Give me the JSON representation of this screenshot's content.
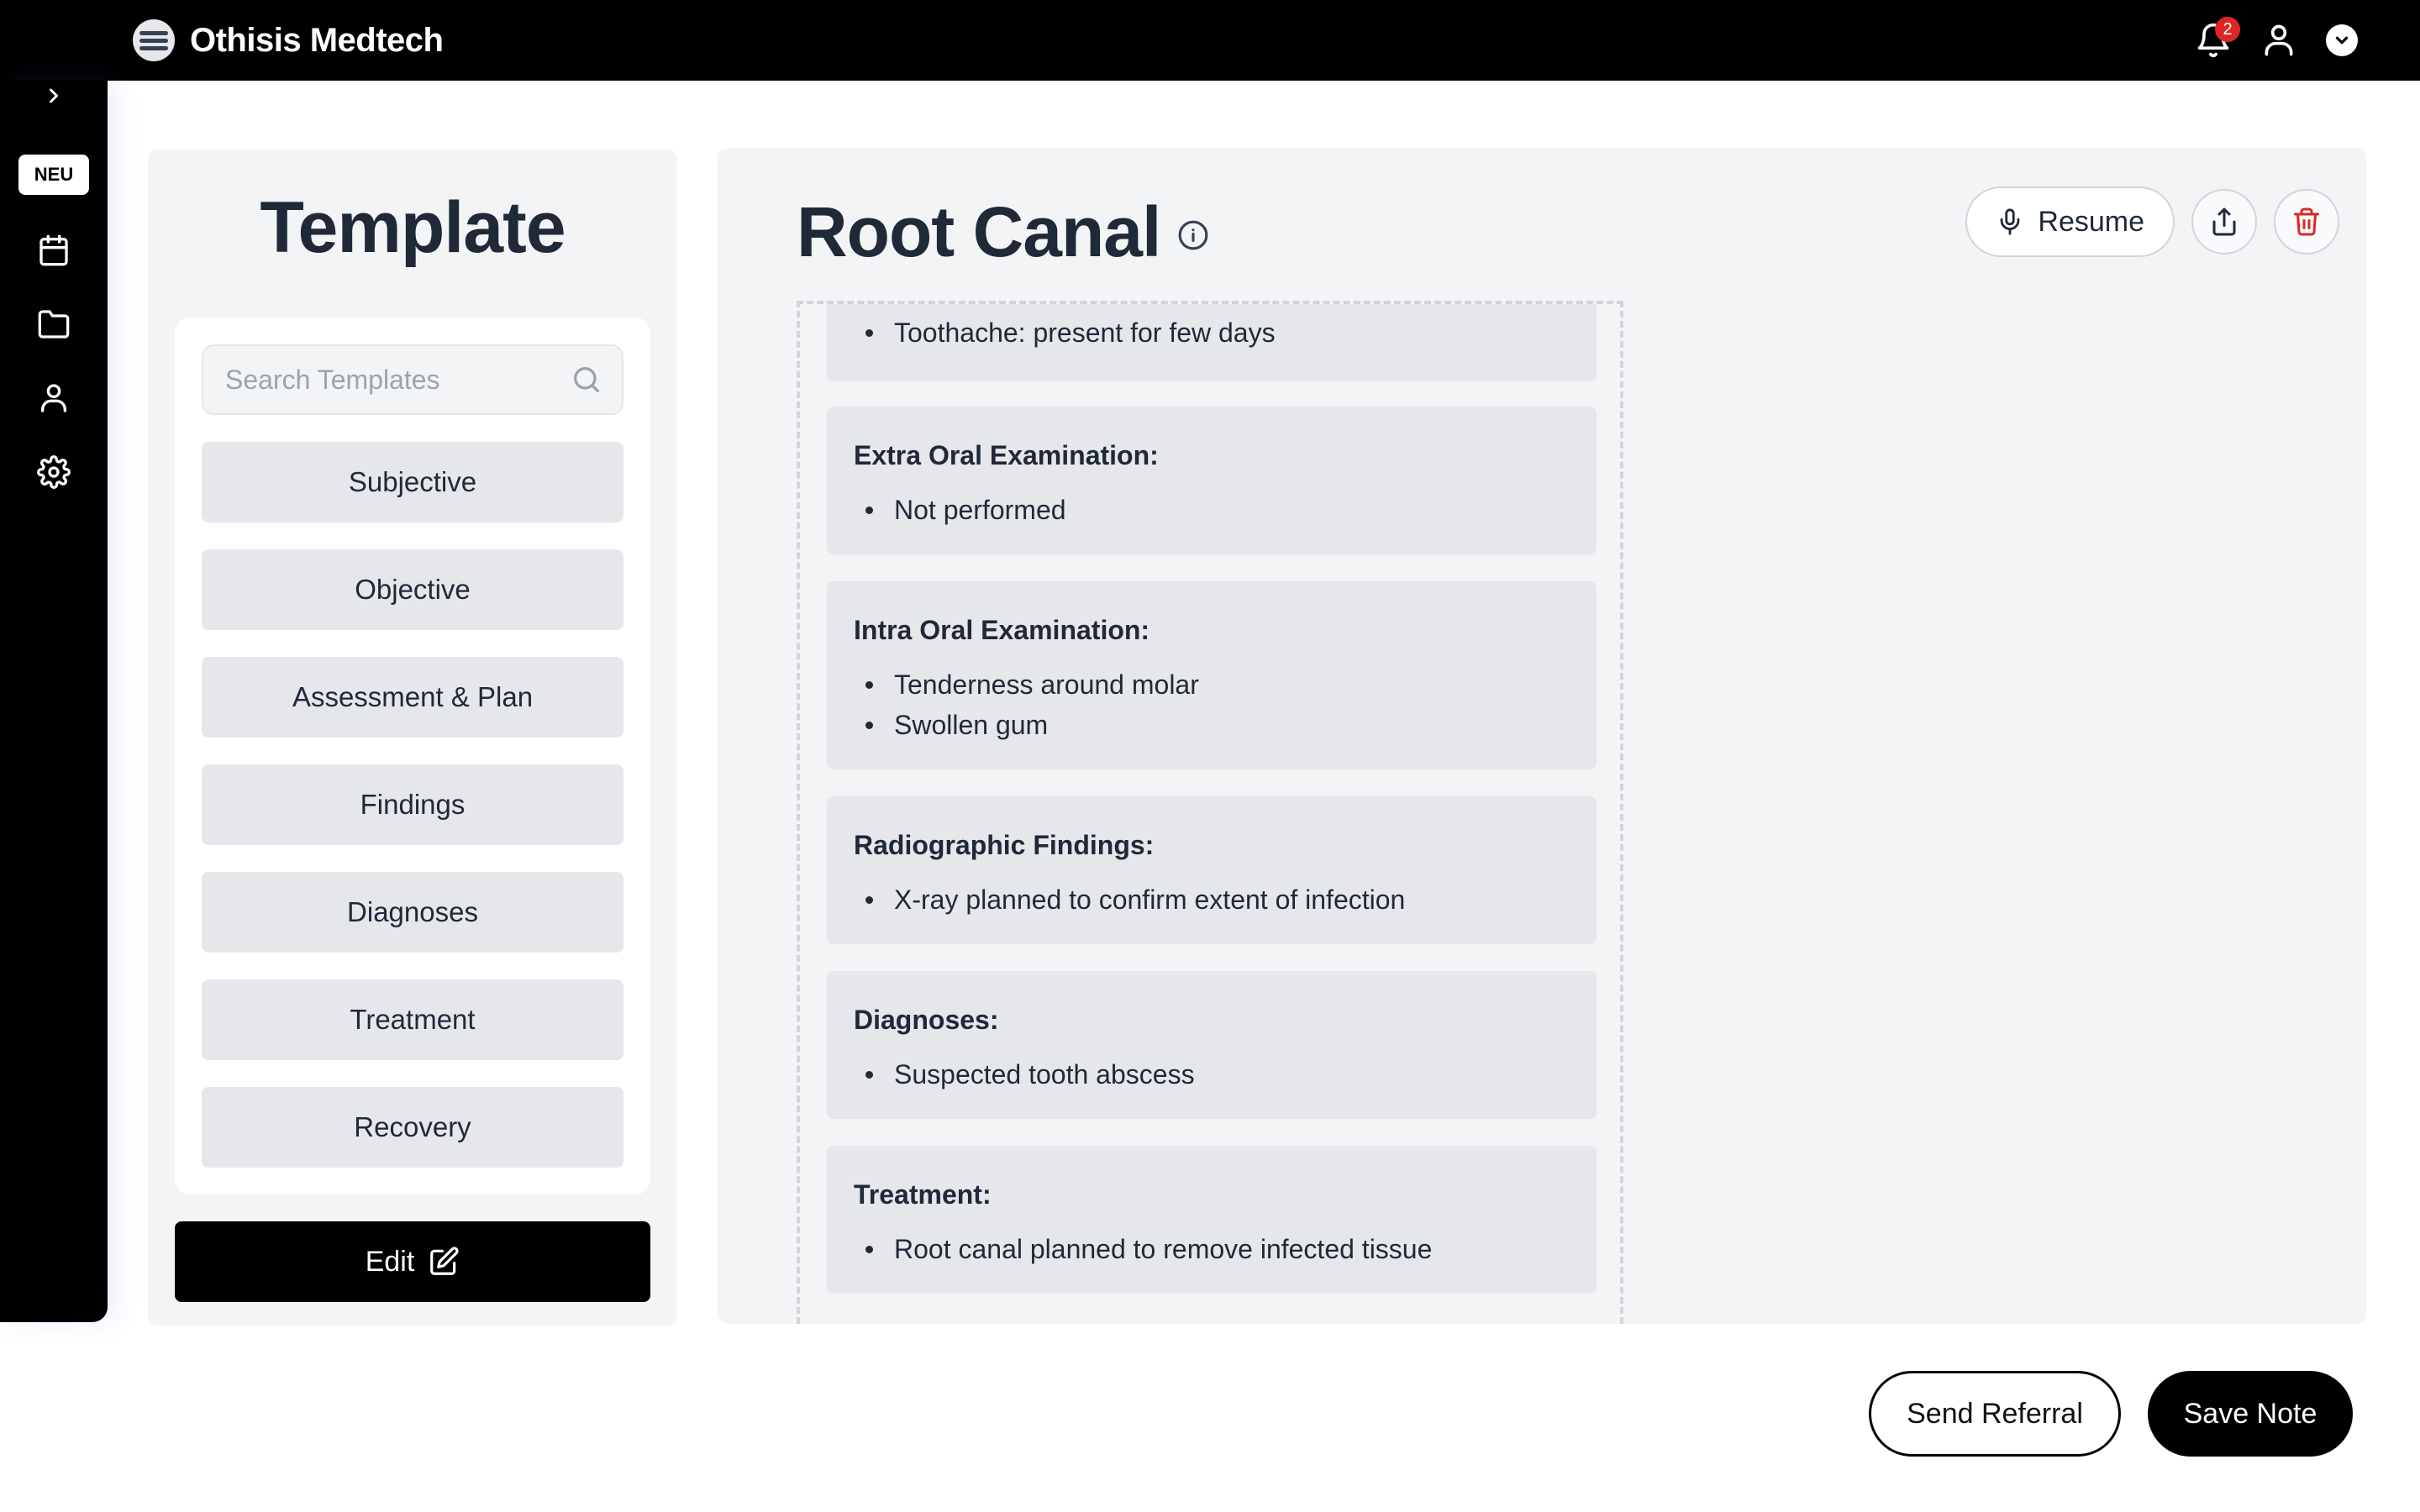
{
  "app": {
    "name": "Othisis Medtech"
  },
  "header": {
    "notification_count": "2",
    "icons": [
      "bell-icon",
      "user-icon",
      "chevron-down-icon"
    ]
  },
  "rail": {
    "badge_label": "NEU",
    "icons": [
      "chevron-right-icon",
      "calendar-icon",
      "folder-icon",
      "user-icon",
      "gear-icon"
    ]
  },
  "templates": {
    "title": "Template",
    "search_placeholder": "Search Templates",
    "items": [
      "Subjective",
      "Objective",
      "Assessment & Plan",
      "Findings",
      "Diagnoses",
      "Treatment",
      "Recovery"
    ],
    "edit_label": "Edit"
  },
  "note": {
    "title": "Root Canal",
    "resume_label": "Resume",
    "sections": [
      {
        "heading": "",
        "items": [
          "Toothache: present for few days"
        ]
      },
      {
        "heading": "Extra Oral Examination:",
        "items": [
          "Not performed"
        ]
      },
      {
        "heading": "Intra Oral Examination:",
        "items": [
          "Tenderness around molar",
          "Swollen gum"
        ]
      },
      {
        "heading": "Radiographic Findings:",
        "items": [
          "X-ray planned to confirm extent of infection"
        ]
      },
      {
        "heading": "Diagnoses:",
        "items": [
          "Suspected tooth abscess"
        ]
      },
      {
        "heading": "Treatment:",
        "items": [
          "Root canal planned to remove infected tissue"
        ]
      }
    ]
  },
  "footer": {
    "send_referral_label": "Send Referral",
    "save_note_label": "Save Note"
  },
  "colors": {
    "delete": "#dc2626",
    "panel": "#f3f4f6",
    "card": "#e5e7eb"
  }
}
